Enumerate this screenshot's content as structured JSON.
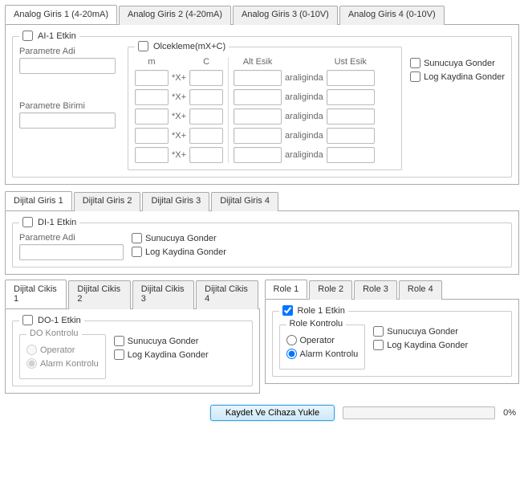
{
  "analog": {
    "tabs": [
      "Analog Giris 1 (4-20mA)",
      "Analog Giris 2 (4-20mA)",
      "Analog Giris 3 (0-10V)",
      "Analog Giris 4 (0-10V)"
    ],
    "enable": "AI-1 Etkin",
    "param_name": "Parametre Adi",
    "param_unit": "Parametre Birimi",
    "scale_title": "Olcekleme(mX+C)",
    "col_m": "m",
    "col_c": "C",
    "col_alt": "Alt Esik",
    "col_ust": "Ust Esik",
    "xplus": "*X+",
    "araliginda": "araliginda",
    "sunucu": "Sunucuya Gonder",
    "log": "Log Kaydina Gonder"
  },
  "digital_in": {
    "tabs": [
      "Dijital Giris 1",
      "Dijital Giris 2",
      "Dijital Giris 3",
      "Dijital Giris 4"
    ],
    "enable": "DI-1 Etkin",
    "param_name": "Parametre Adi",
    "sunucu": "Sunucuya Gonder",
    "log": "Log Kaydina Gonder"
  },
  "digital_out": {
    "tabs": [
      "Dijital Cikis 1",
      "Dijital Cikis 2",
      "Dijital Cikis 3",
      "Dijital Cikis 4"
    ],
    "enable": "DO-1 Etkin",
    "control": "DO Kontrolu",
    "operator": "Operator",
    "alarm": "Alarm Kontrolu",
    "sunucu": "Sunucuya Gonder",
    "log": "Log Kaydina Gonder"
  },
  "role": {
    "tabs": [
      "Role 1",
      "Role 2",
      "Role 3",
      "Role 4"
    ],
    "enable": "Role 1 Etkin",
    "control": "Role Kontrolu",
    "operator": "Operator",
    "alarm": "Alarm Kontrolu",
    "sunucu": "Sunucuya Gonder",
    "log": "Log Kaydina Gonder"
  },
  "footer": {
    "save": "Kaydet Ve Cihaza Yukle",
    "progress": "0%"
  }
}
